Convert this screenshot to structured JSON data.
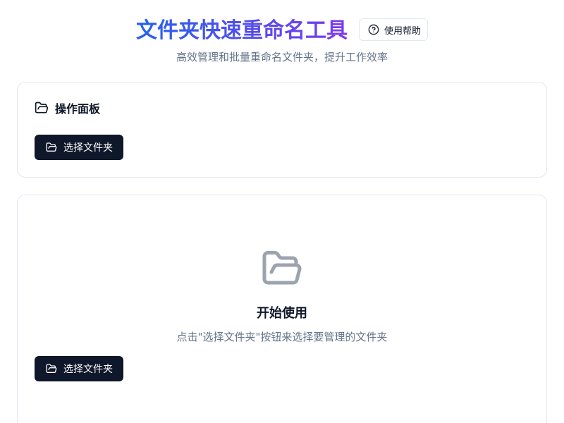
{
  "header": {
    "title": "文件夹快速重命名工具",
    "help_label": "使用帮助",
    "subtitle": "高效管理和批量重命名文件夹，提升工作效率"
  },
  "operations_panel": {
    "title": "操作面板",
    "select_button_label": "选择文件夹"
  },
  "empty_state": {
    "title": "开始使用",
    "description": "点击\"选择文件夹\"按钮来选择要管理的文件夹",
    "select_button_label": "选择文件夹"
  },
  "icons": {
    "help": "help-circle-icon",
    "folder": "folder-open-icon"
  },
  "colors": {
    "title_gradient_start": "#2563eb",
    "title_gradient_end": "#7c3aed",
    "primary_button": "#0f172a",
    "muted_text": "#64748b",
    "border": "#e2e8f0",
    "empty_icon": "#9ca3af"
  }
}
